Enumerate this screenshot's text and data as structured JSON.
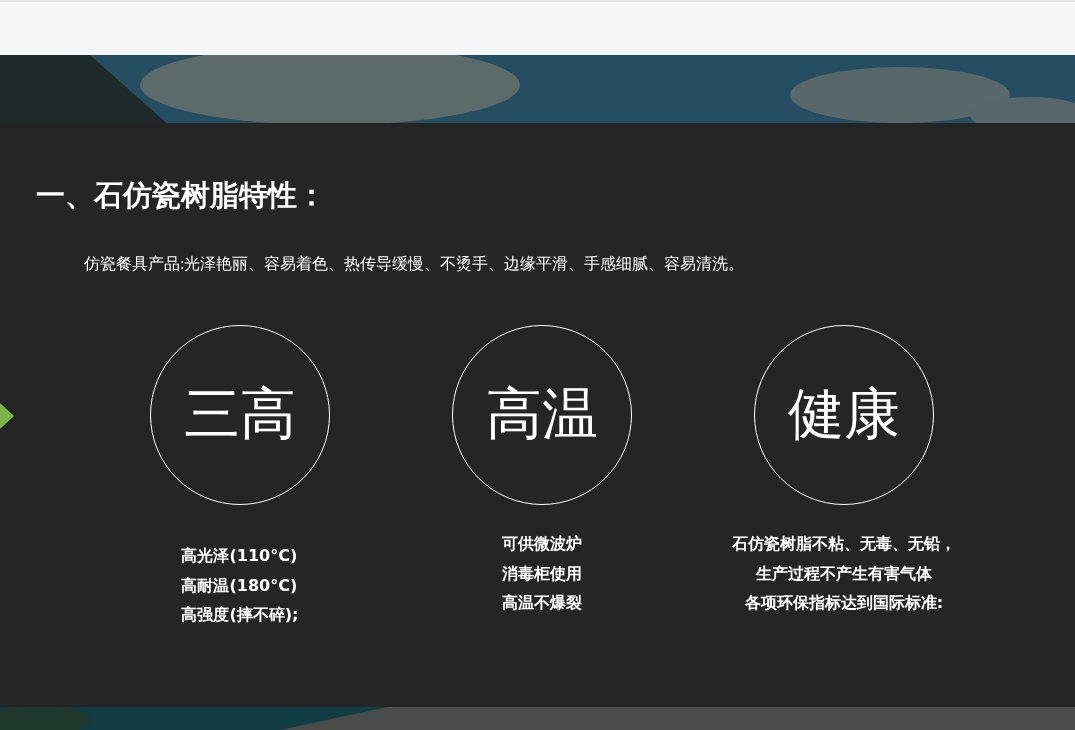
{
  "section": {
    "title": "一、石仿瓷树脂特性：",
    "intro": "仿瓷餐具产品:光泽艳丽、容易着色、热传导缓慢、不烫手、边缘平滑、手感细腻、容易清洗。",
    "features": [
      {
        "badge": "三高",
        "kind": "list",
        "lines": [
          "高光泽(110°C)",
          "高耐温(180°C)",
          "高强度(摔不碎);"
        ]
      },
      {
        "badge": "高温",
        "kind": "centered",
        "lines": [
          "可供微波炉",
          "消毒柜使用",
          "高温不爆裂"
        ]
      },
      {
        "badge": "健康",
        "kind": "centered",
        "lines": [
          "石仿瓷树脂不粘、无毒、无铅，",
          "生产过程不产生有害气体",
          "各项环保指标达到国际标准:"
        ]
      }
    ]
  }
}
